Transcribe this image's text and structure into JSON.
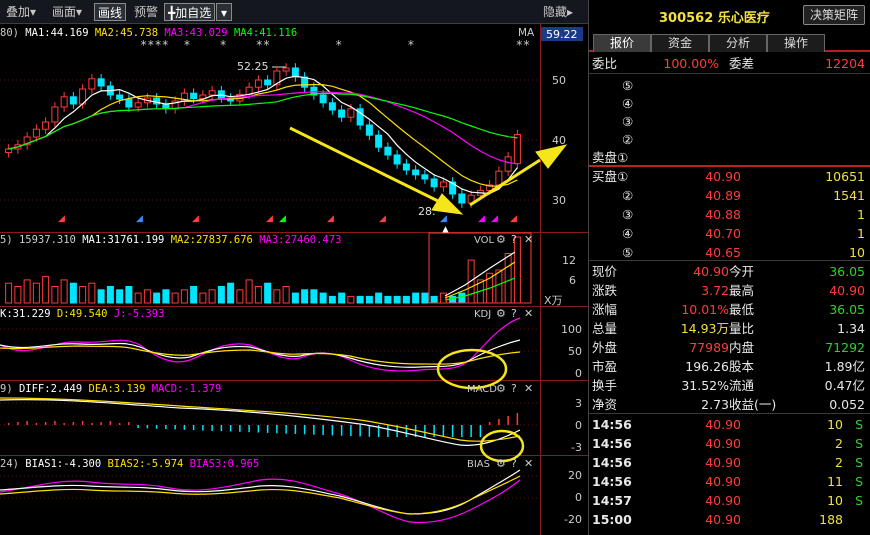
{
  "toolbar": {
    "items": [
      "叠加▾",
      "画面▾"
    ],
    "active": "画线",
    "warn": "预警",
    "add": "╋加自选",
    "hide": "隐藏▸"
  },
  "header": {
    "code": "300562 乐心医疗",
    "btn": "决策矩阵"
  },
  "tabs": [
    "报价",
    "资金",
    "分析",
    "操作"
  ],
  "weibi": {
    "label": "委比",
    "value": "100.00%",
    "label2": "委差",
    "value2": "12204"
  },
  "sell": [
    {
      "label": "⑤",
      "price": "",
      "vol": ""
    },
    {
      "label": "④",
      "price": "",
      "vol": ""
    },
    {
      "label": "③",
      "price": "",
      "vol": ""
    },
    {
      "label": "②",
      "price": "",
      "vol": ""
    },
    {
      "label": "卖盘①",
      "price": "",
      "vol": ""
    }
  ],
  "buy": [
    {
      "label": "买盘①",
      "price": "40.90",
      "vol": "10651"
    },
    {
      "label": "②",
      "price": "40.89",
      "vol": "1541"
    },
    {
      "label": "③",
      "price": "40.88",
      "vol": "1"
    },
    {
      "label": "④",
      "price": "40.70",
      "vol": "1"
    },
    {
      "label": "⑤",
      "price": "40.65",
      "vol": "10"
    }
  ],
  "stats": [
    {
      "l1": "现价",
      "v1": "40.90",
      "c1": "red",
      "l2": "今开",
      "v2": "36.05",
      "c2": "green"
    },
    {
      "l1": "涨跌",
      "v1": "3.72",
      "c1": "red",
      "l2": "最高",
      "v2": "40.90",
      "c2": "red"
    },
    {
      "l1": "涨幅",
      "v1": "10.01%",
      "c1": "red",
      "l2": "最低",
      "v2": "36.05",
      "c2": "green"
    },
    {
      "l1": "总量",
      "v1": "14.93万",
      "c1": "yellow",
      "l2": "量比",
      "v2": "1.34",
      "c2": "white"
    },
    {
      "l1": "外盘",
      "v1": "77989",
      "c1": "red",
      "l2": "内盘",
      "v2": "71292",
      "c2": "green"
    },
    {
      "l1": "市盈",
      "v1": "196.26",
      "c1": "white",
      "l2": "股本",
      "v2": "1.89亿",
      "c2": "white"
    },
    {
      "l1": "换手",
      "v1": "31.52%",
      "c1": "white",
      "l2": "流通",
      "v2": "0.47亿",
      "c2": "white"
    },
    {
      "l1": "净资",
      "v1": "2.73",
      "c1": "white",
      "l2": "收益(一)",
      "v2": "0.052",
      "c2": "white"
    }
  ],
  "ticks": [
    {
      "t": "14:56",
      "p": "40.90",
      "v": "10",
      "s": "S"
    },
    {
      "t": "14:56",
      "p": "40.90",
      "v": "2",
      "s": "S"
    },
    {
      "t": "14:56",
      "p": "40.90",
      "v": "2",
      "s": "S"
    },
    {
      "t": "14:56",
      "p": "40.90",
      "v": "11",
      "s": "S"
    },
    {
      "t": "14:57",
      "p": "40.90",
      "v": "10",
      "s": "S"
    },
    {
      "t": "15:00",
      "p": "40.90",
      "v": "188",
      "s": ""
    }
  ],
  "panels": {
    "main": {
      "legend": "80)  MA1:44.169   MA2:45.738   MA3:43.029   MA4:41.116",
      "tag": "MA",
      "price_box": "59.22",
      "hi_label": "52.25",
      "lo_label": "28.",
      "stars": "****  *    *    **         *         *              **",
      "axis": [
        "50",
        "40",
        "30"
      ]
    },
    "vol": {
      "legend": "5)  15937.310   MA1:31761.199   MA2:27837.676   MA3:27460.473",
      "tag": "VOL",
      "axis": [
        "12",
        "6"
      ],
      "unit": "X万"
    },
    "kdj": {
      "legend": "K:31.229    D:49.540    J:-5.393",
      "tag": "KDJ",
      "axis": [
        "100",
        "50",
        "0"
      ]
    },
    "macd": {
      "legend": "9)  DIFF:2.449   DEA:3.139   MACD:-1.379",
      "tag": "MACD",
      "axis": [
        "3",
        "0",
        "-3"
      ]
    },
    "bias": {
      "legend": "24)  BIAS1:-4.300   BIAS2:-5.974   BIAS3:0.965",
      "tag": "BIAS",
      "axis": [
        "20",
        "0",
        "-20"
      ]
    }
  },
  "colors": {
    "up": "#ff3b3b",
    "down": "#00e5ff",
    "ma1": "#ffffff",
    "ma2": "#ffe000",
    "ma3": "#ff00ff",
    "ma4": "#00ff00",
    "bg": "#000000",
    "grid": "#8b1a1a",
    "annot": "#f5e619"
  },
  "chart_data": {
    "type": "candlestick",
    "closes": [
      38.5,
      39.2,
      40.5,
      41.8,
      43.0,
      45.5,
      47.2,
      46.0,
      48.5,
      50.2,
      49.0,
      47.5,
      46.8,
      45.5,
      46.2,
      47.0,
      46.0,
      45.2,
      46.5,
      47.8,
      46.9,
      47.5,
      48.2,
      47.0,
      46.5,
      47.6,
      48.8,
      50.0,
      49.2,
      51.5,
      52.0,
      50.5,
      48.8,
      47.5,
      46.2,
      45.0,
      43.8,
      45.2,
      42.5,
      40.8,
      38.8,
      37.5,
      36.0,
      35.0,
      34.2,
      33.5,
      32.2,
      33.0,
      31.0,
      29.5,
      30.8,
      31.6,
      32.5,
      34.8,
      37.2,
      40.9
    ],
    "volumes": [
      6,
      5,
      7,
      6,
      8,
      5,
      7,
      6,
      5,
      6,
      4,
      5,
      4,
      5,
      3,
      4,
      3,
      4,
      3,
      4,
      5,
      3,
      4,
      5,
      6,
      4,
      7,
      5,
      6,
      4,
      5,
      3,
      4,
      4,
      3,
      2,
      3,
      2,
      2,
      2,
      3,
      2,
      2,
      2,
      3,
      3,
      2,
      3,
      2,
      3,
      13,
      7,
      9,
      10,
      15,
      20
    ],
    "hi_price": 52.25,
    "lo_price": 28,
    "price_axis": [
      30,
      40,
      50
    ]
  }
}
